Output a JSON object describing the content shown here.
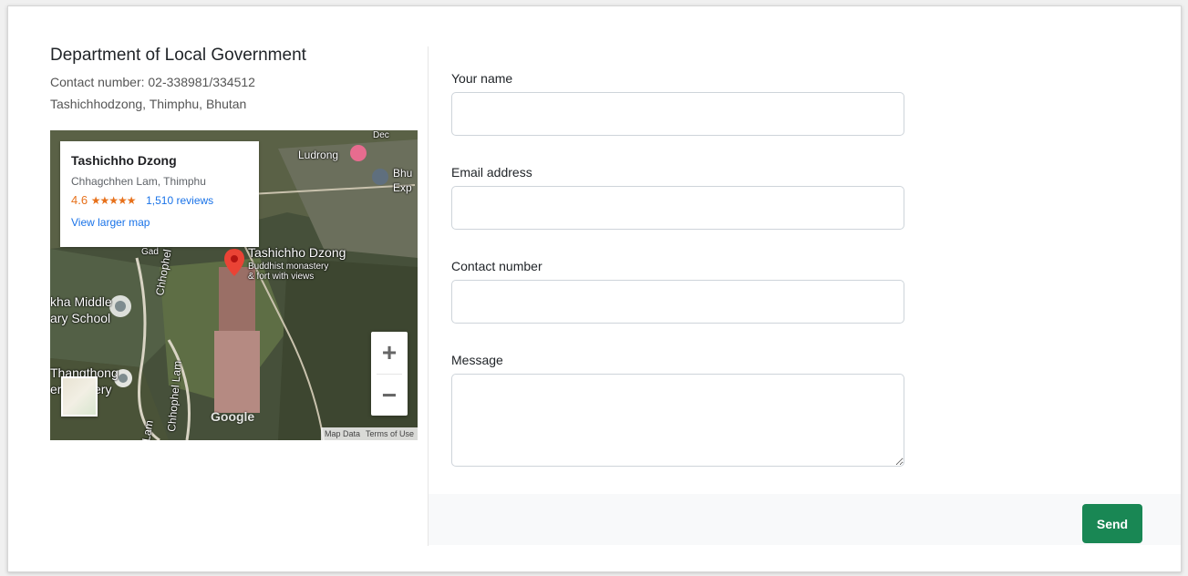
{
  "department": {
    "title": "Department of Local Government",
    "contact": "Contact number: 02-338981/334512",
    "address": "Tashichhodzong, Thimphu, Bhutan"
  },
  "map": {
    "info_card": {
      "title": "Tashichho Dzong",
      "subtitle": "Chhagchhen Lam, Thimphu",
      "rating": "4.6",
      "stars": "★★★★★",
      "reviews": "1,510 reviews",
      "view_larger": "View larger map"
    },
    "labels": {
      "ludrong": "Ludrong",
      "bhu": "Bhu",
      "exp": "Exp",
      "dzong_name": "Tashichho Dzong",
      "dzong_desc1": "Buddhist monastery",
      "dzong_desc2": "& fort with views",
      "school1": "kha Middle",
      "school2": "ary School",
      "thangthong1": "Thangthong",
      "thangthong2": "er",
      "thangthong3": "ery",
      "chhophel1": "Chhophel L",
      "chhophel2": "Chhophel Lam",
      "lam": "Lam",
      "dec": "Dec",
      "gad": "Gad"
    },
    "zoom_in": "+",
    "zoom_out": "−",
    "google": "Google",
    "map_data": "Map Data",
    "terms": "Terms of Use"
  },
  "form": {
    "name_label": "Your name",
    "email_label": "Email address",
    "contact_label": "Contact number",
    "message_label": "Message",
    "send_label": "Send"
  }
}
